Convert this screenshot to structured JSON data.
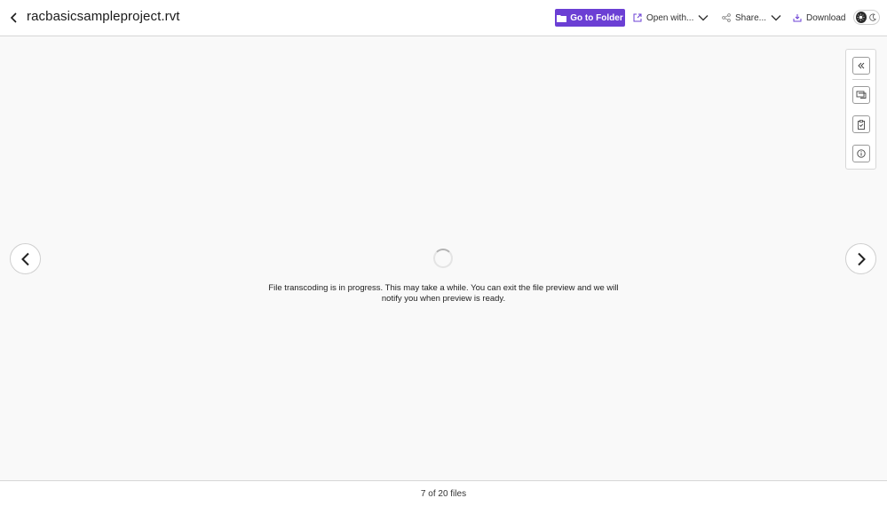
{
  "header": {
    "file_title": "racbasicsampleproject.rvt",
    "go_to_folder_label": "Go to Folder",
    "open_with_label": "Open with...",
    "share_label": "Share...",
    "download_label": "Download",
    "accent_color": "#6b3fd4"
  },
  "side_panel": {
    "icons": [
      "collapse-double-chevron-left-icon",
      "comments-icon",
      "clipboard-check-icon",
      "info-icon"
    ]
  },
  "viewer": {
    "status_message": "File transcoding is in progress. This may take a while. You can exit the file preview and we will notify you when preview is ready."
  },
  "footer": {
    "file_counter": "7 of 20 files"
  }
}
